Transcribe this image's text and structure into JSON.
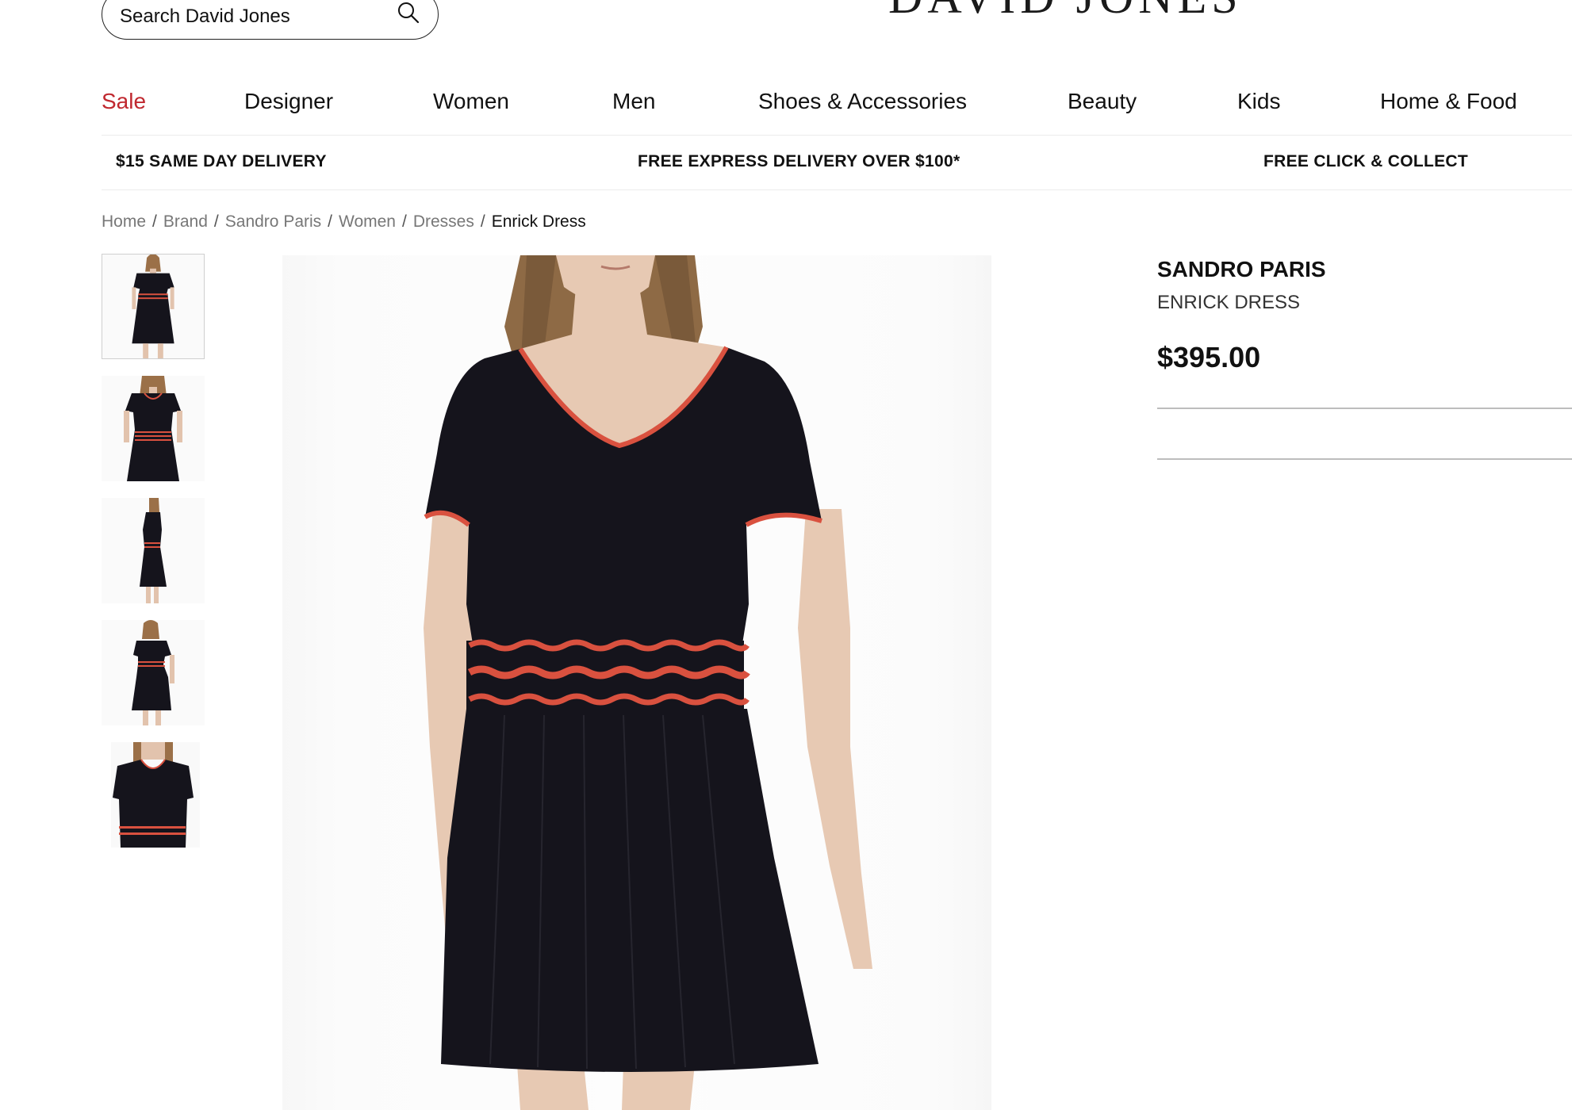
{
  "header": {
    "search_placeholder": "Search David Jones",
    "logo": "DAVID JONES"
  },
  "nav": {
    "items": [
      "Sale",
      "Designer",
      "Women",
      "Men",
      "Shoes & Accessories",
      "Beauty",
      "Kids",
      "Home & Food"
    ]
  },
  "promos": [
    "$15 SAME DAY DELIVERY",
    "FREE EXPRESS DELIVERY OVER $100*",
    "FREE CLICK & COLLECT"
  ],
  "breadcrumb": {
    "links": [
      "Home",
      "Brand",
      "Sandro Paris",
      "Women",
      "Dresses"
    ],
    "separator": "/",
    "current": "Enrick Dress"
  },
  "product": {
    "brand": "SANDRO PARIS",
    "name": "ENRICK DRESS",
    "price": "$395.00"
  },
  "colors": {
    "sale": "#c0282f",
    "dress": "#15141c",
    "trim": "#d9513f"
  },
  "icons": {
    "search": "search-icon"
  }
}
